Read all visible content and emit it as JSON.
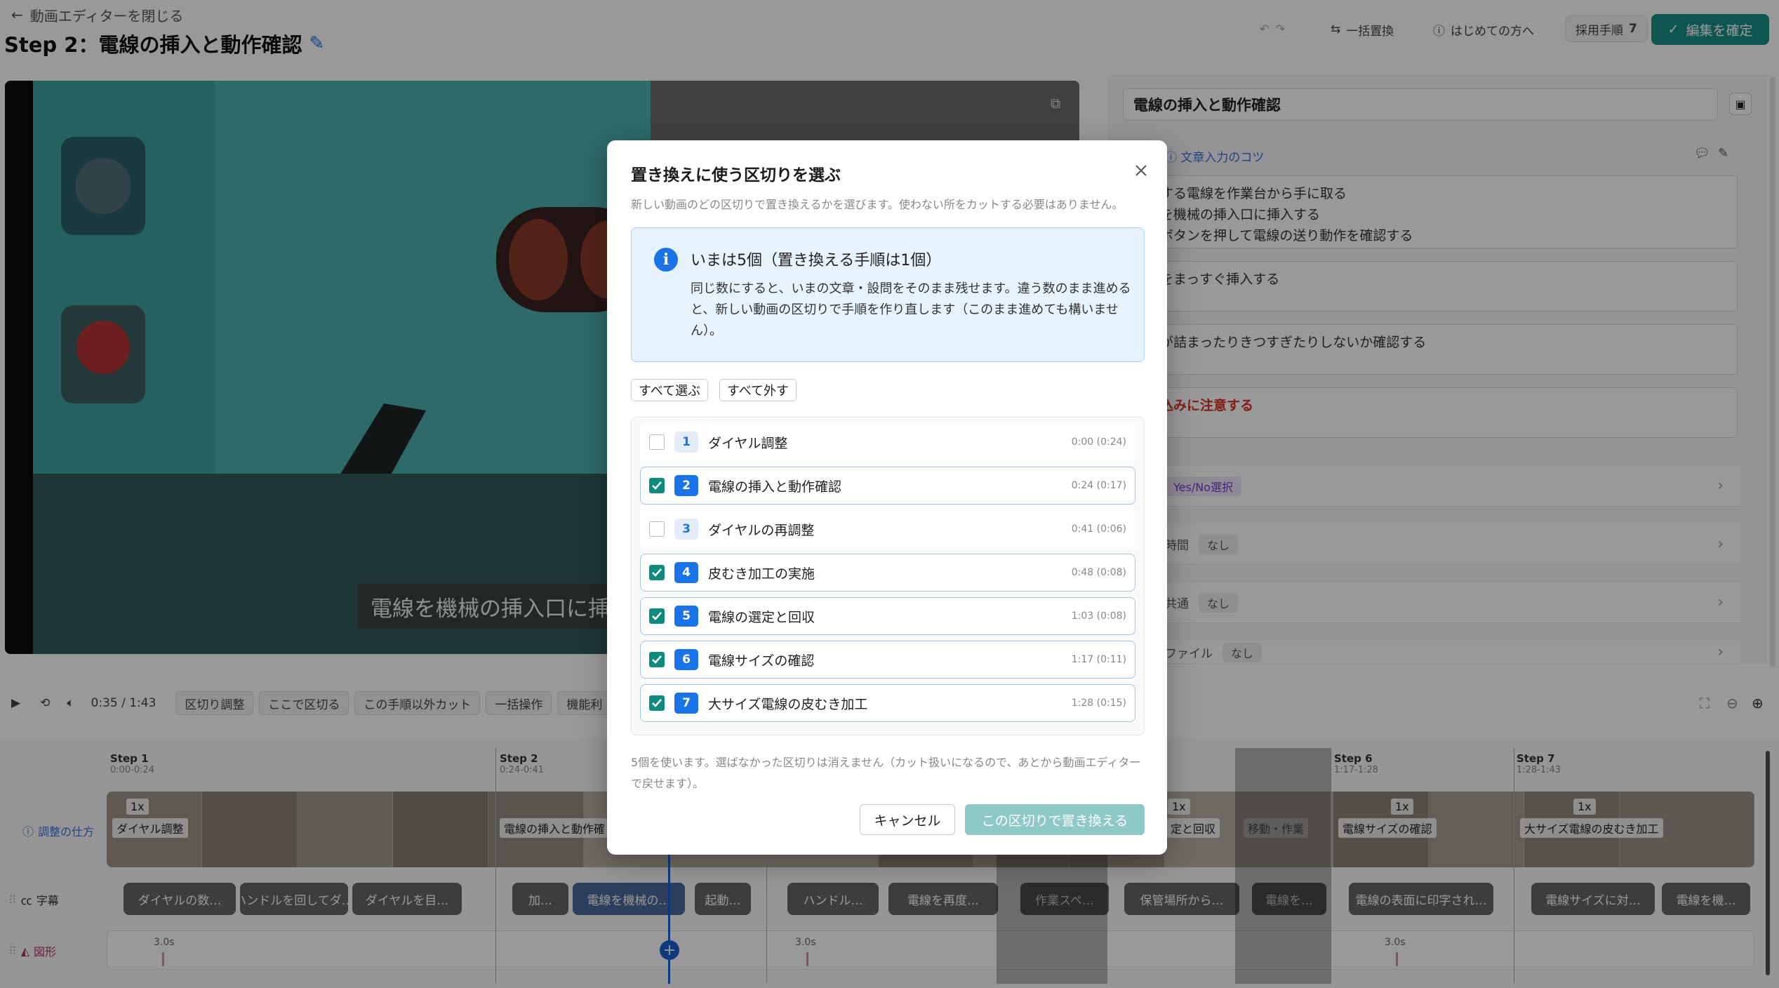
{
  "header": {
    "back_label": "動画エディターを閉じる",
    "title": "Step 2：電線の挿入と動作確認",
    "bulk_replace": "一括置換",
    "first_time": "はじめての方へ",
    "adopted_label": "採用手順",
    "adopted_count": "7",
    "confirm_label": "編集を確定"
  },
  "video": {
    "caption": "電線を機械の挿入口に挿入"
  },
  "right_panel": {
    "title_value": "電線の挿入と動作確認",
    "tips_label": "文章入力のコツ",
    "main_text": "加工する電線を作業台から手に取る\n電線を機械の挿入口に挿入する\n起動ボタンを押して電線の送り動作を確認する",
    "text2": "電線をまっすぐ挿入する",
    "text3": "電線が詰まったりきつすぎたりしないか確認する",
    "warning": "巻き込みに注意する",
    "row_yesno": "Yes/No選択",
    "row_time_label": "時間",
    "row_time_value": "なし",
    "row_common_label": "共通",
    "row_common_value": "なし",
    "row_file_label": "ファイル",
    "row_file_value": "なし"
  },
  "controls": {
    "time": "0:35 / 1:43",
    "btn_cut_adjust": "区切り調整",
    "btn_cut_here": "ここで区切る",
    "btn_cut_other": "この手順以外カット",
    "btn_bulk": "一括操作",
    "btn_machine": "機能利"
  },
  "timeline": {
    "steps": [
      {
        "label": "Step 1",
        "time": "0:00-0:24"
      },
      {
        "label": "Step 2",
        "time": "0:24-0:41"
      },
      {
        "label": "Step 6",
        "time": "1:17-1:28"
      },
      {
        "label": "Step 7",
        "time": "1:28-1:43"
      }
    ],
    "row_how": "調整の仕方",
    "row_subtitle": "字幕",
    "row_shape": "図形",
    "seg_labels": [
      "ダイヤル調整",
      "電線の挿入と動作確",
      "定と回収",
      "移動・作業",
      "電線サイズの確認",
      "大サイズ電線の皮むき加工"
    ],
    "speed": "1x",
    "subtitles": [
      "ダイヤルの数…",
      "ハンドルを回してダ…",
      "ダイヤルを目…",
      "加…",
      "電線を機械の…",
      "起動…",
      "ハンドル…",
      "電線を再度…",
      "作業スペ…",
      "保管場所から…",
      "電線を…",
      "電線の表面に印字され…",
      "電線サイズに対…",
      "電線を機…"
    ],
    "shape_durations": [
      "3.0s",
      "3.0s",
      "3.0s"
    ]
  },
  "modal": {
    "title": "置き換えに使う区切りを選ぶ",
    "desc": "新しい動画のどの区切りで置き換えるかを選びます。使わない所をカットする必要はありません。",
    "info_head": "いまは5個（置き換える手順は1個）",
    "info_body": "同じ数にすると、いまの文章・設問をそのまま残せます。違う数のまま進めると、新しい動画の区切りで手順を作り直します（このまま進めても構いません）。",
    "select_all": "すべて選ぶ",
    "deselect_all": "すべて外す",
    "items": [
      {
        "num": "1",
        "name": "ダイヤル調整",
        "time": "0:00 (0:24)",
        "checked": false
      },
      {
        "num": "2",
        "name": "電線の挿入と動作確認",
        "time": "0:24 (0:17)",
        "checked": true
      },
      {
        "num": "3",
        "name": "ダイヤルの再調整",
        "time": "0:41 (0:06)",
        "checked": false
      },
      {
        "num": "4",
        "name": "皮むき加工の実施",
        "time": "0:48 (0:08)",
        "checked": true
      },
      {
        "num": "5",
        "name": "電線の選定と回収",
        "time": "1:03 (0:08)",
        "checked": true
      },
      {
        "num": "6",
        "name": "電線サイズの確認",
        "time": "1:17 (0:11)",
        "checked": true
      },
      {
        "num": "7",
        "name": "大サイズ電線の皮むき加工",
        "time": "1:28 (0:15)",
        "checked": true
      }
    ],
    "footer": "5個を使います。選ばなかった区切りは消えません（カット扱いになるので、あとから動画エディターで戻せます）。",
    "cancel": "キャンセル",
    "ok": "この区切りで置き換える"
  },
  "colors": {
    "accent": "#1b73e8",
    "teal": "#0f8a7f",
    "warning": "#d93025"
  }
}
